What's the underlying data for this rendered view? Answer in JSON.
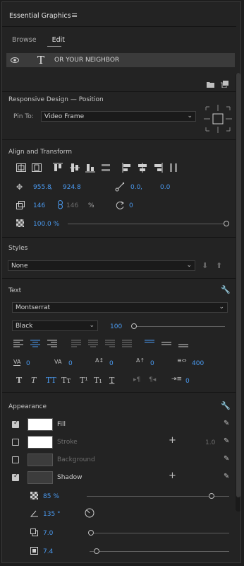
{
  "header": {
    "title": "Essential Graphics",
    "menu_icon": "hamburger-icon"
  },
  "tabs": [
    {
      "label": "Browse",
      "active": false
    },
    {
      "label": "Edit",
      "active": true
    }
  ],
  "layer": {
    "name": "OR YOUR NEIGHBOR",
    "glyph": "T"
  },
  "responsive": {
    "title": "Responsive Design — Position",
    "pin_label": "Pin To:",
    "pin_value": "Video Frame"
  },
  "align": {
    "title": "Align and Transform",
    "position_x": "955.8",
    "position_sep": ",",
    "position_y": "924.8",
    "anchor_x": "0.0",
    "anchor_sep": ",",
    "anchor_y": "0.0",
    "scale_w": "146",
    "scale_h": "146",
    "scale_unit": "%",
    "rotation": "0",
    "opacity": "100.0 %"
  },
  "styles": {
    "title": "Styles",
    "value": "None"
  },
  "text": {
    "title": "Text",
    "font": "Montserrat",
    "weight": "Black",
    "size": "100",
    "kerning": "0",
    "tracking": "0",
    "leading": "0",
    "baseline": "0",
    "tsume": "400",
    "indent": "0",
    "style_glyphs": [
      "T",
      "T",
      "TT",
      "Tт",
      "T¹",
      "T₁",
      "T"
    ]
  },
  "appearance": {
    "title": "Appearance",
    "fill_label": "Fill",
    "stroke_label": "Stroke",
    "stroke_width": "1.0",
    "background_label": "Background",
    "shadow_label": "Shadow",
    "shadow_opacity": "85 %",
    "shadow_angle": "135 °",
    "shadow_distance": "7.0",
    "shadow_size": "7.4",
    "fill_color": "#ffffff",
    "stroke_color": "#ffffff",
    "background_color": "#3c3c3c",
    "shadow_color": "#3c3c3c"
  },
  "colors": {
    "accent": "#4a9af0",
    "panel": "#232323",
    "text": "#cfcfcf"
  }
}
